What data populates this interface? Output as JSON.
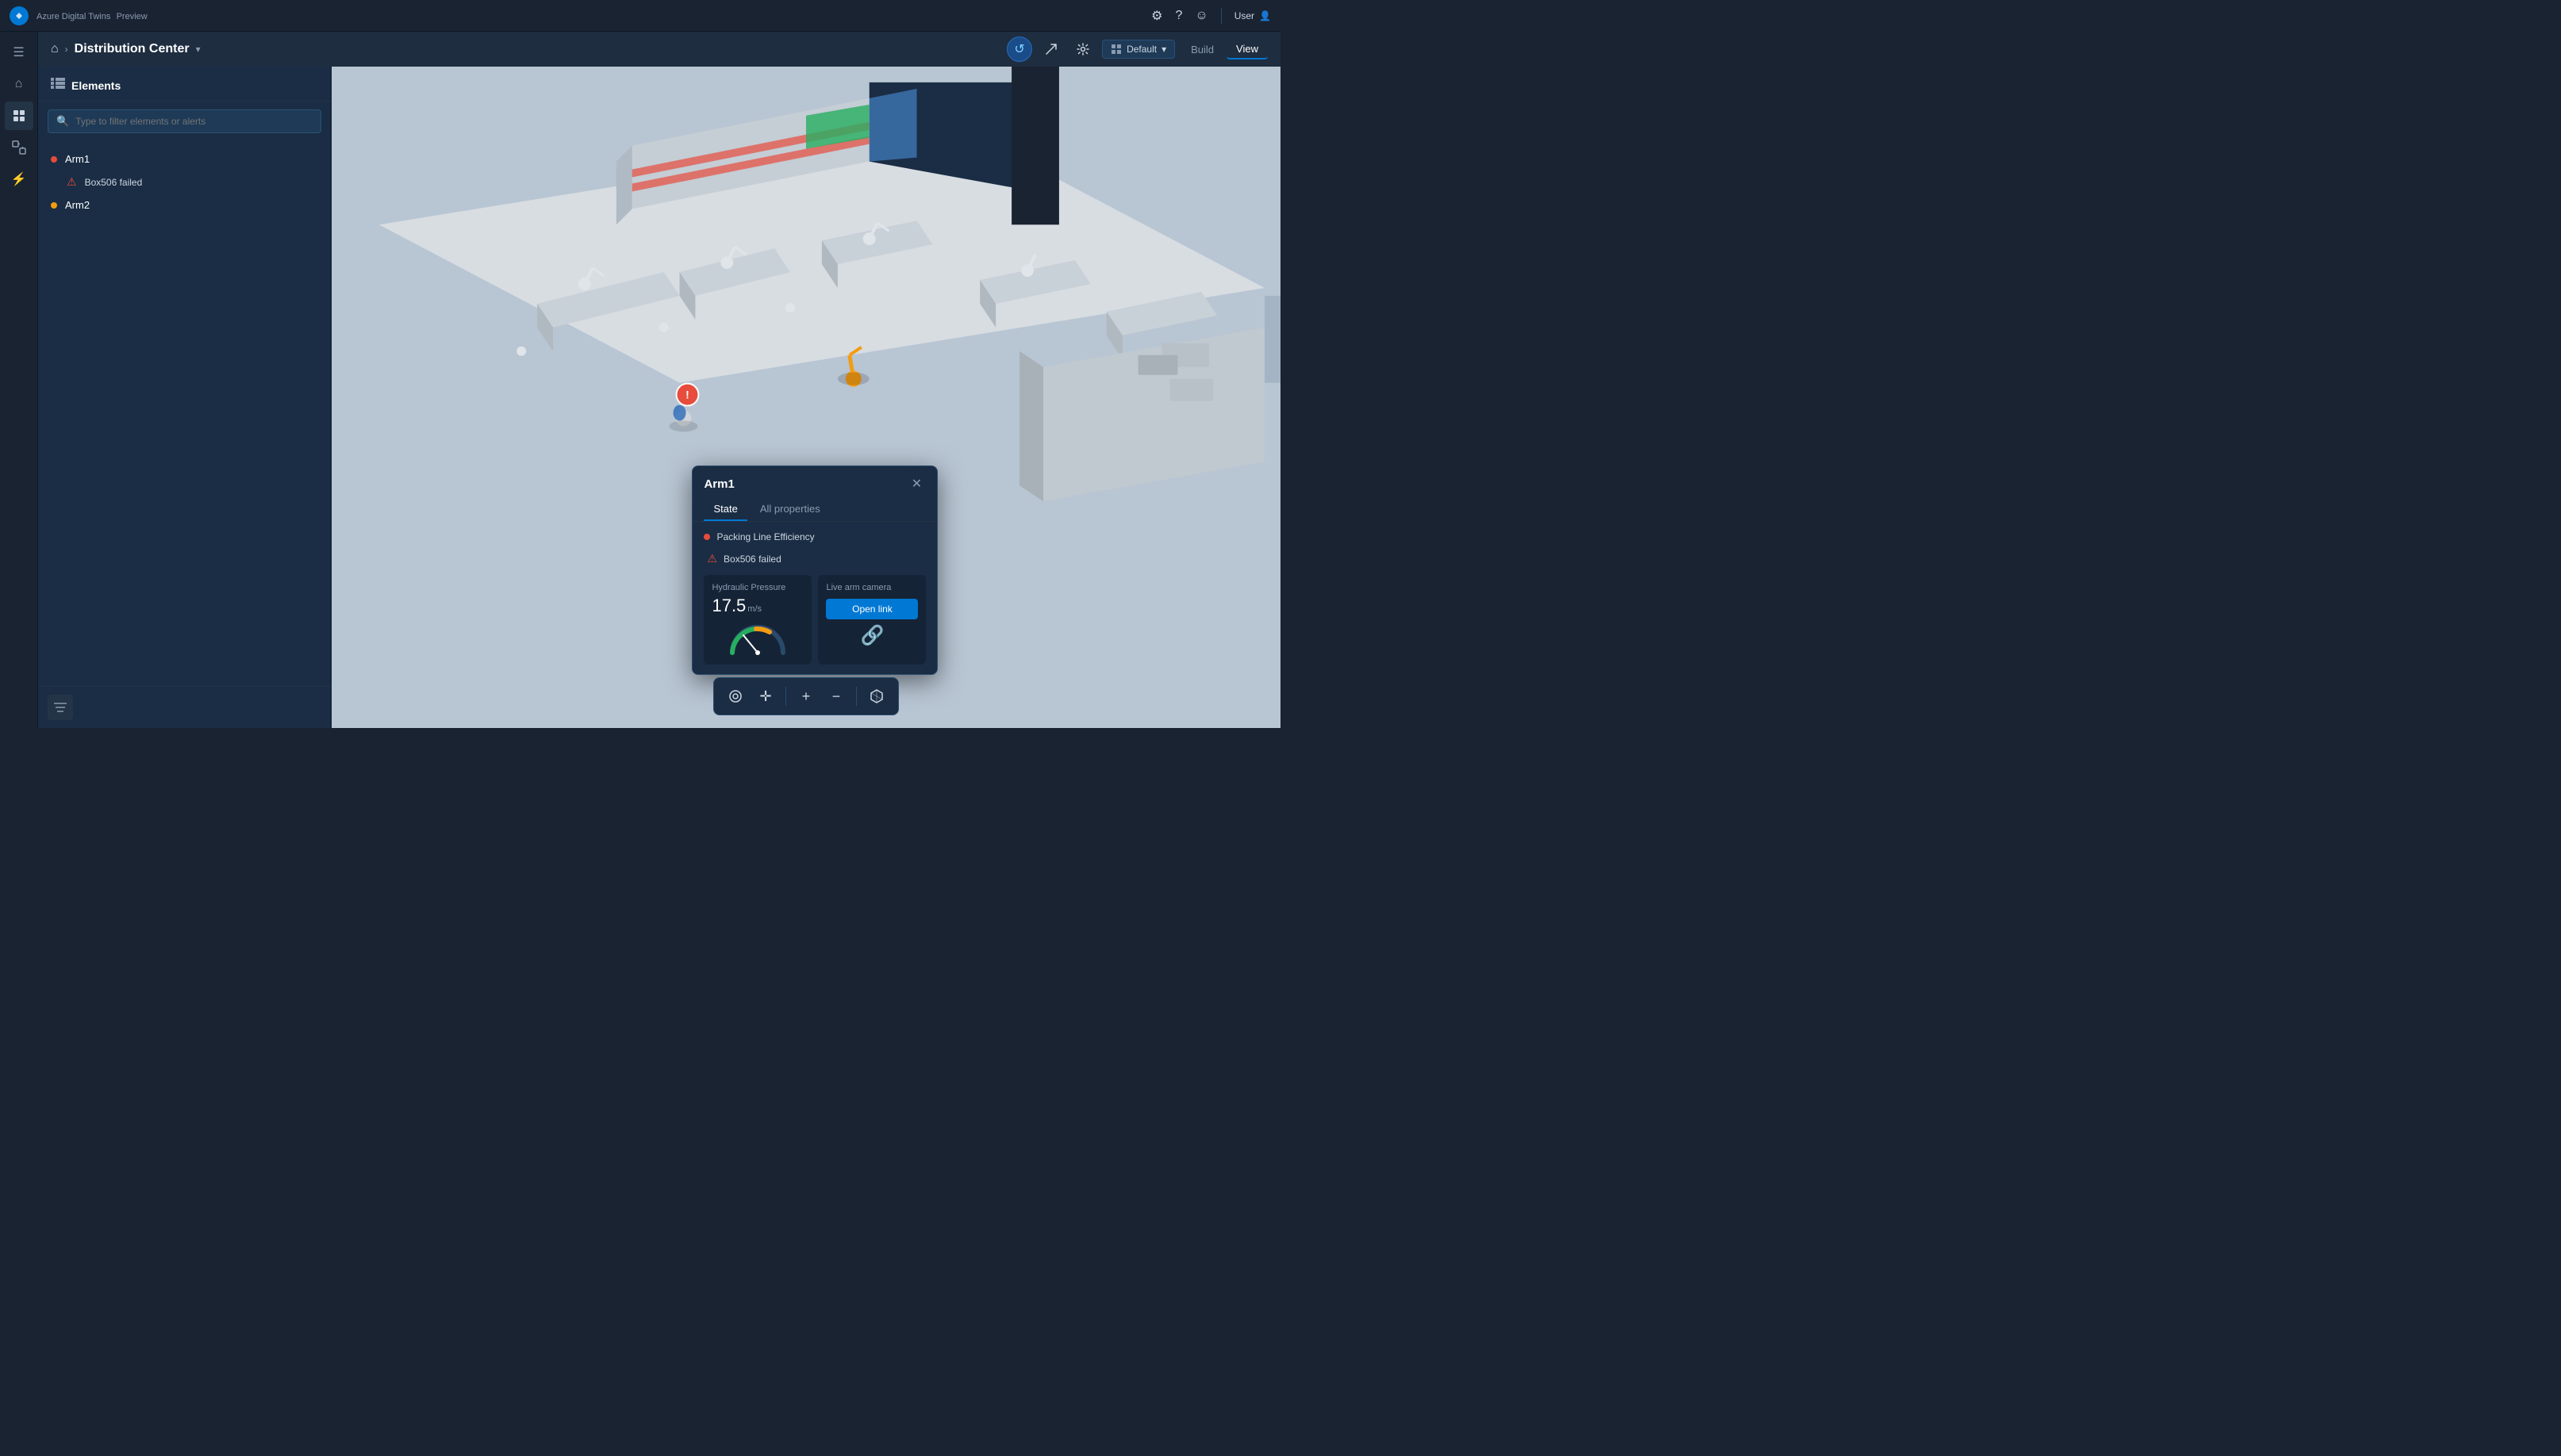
{
  "app": {
    "logo": "A",
    "name": "Azure Digital Twins",
    "preview_label": "Preview",
    "user": "User",
    "icons": {
      "settings": "⚙",
      "help": "?",
      "emoji": "☺",
      "user_manage": "👤"
    }
  },
  "topbar": {
    "settings_label": "Settings",
    "help_label": "Help",
    "user_label": "User"
  },
  "breadcrumb": {
    "home_icon": "⌂",
    "separator": "›",
    "title": "Distribution Center",
    "chevron": "▾"
  },
  "toolbar": {
    "refresh_icon": "↺",
    "share_icon": "↗",
    "settings_icon": "⚙",
    "dropdown_label": "Default",
    "build_label": "Build",
    "view_label": "View"
  },
  "sidebar": {
    "title": "Elements",
    "search_placeholder": "Type to filter elements or alerts",
    "items": [
      {
        "id": "arm1",
        "name": "Arm1",
        "status": "red",
        "children": [
          {
            "id": "box506",
            "name": "Box506 failed",
            "type": "alert"
          }
        ]
      },
      {
        "id": "arm2",
        "name": "Arm2",
        "status": "orange",
        "children": []
      }
    ],
    "filter_icon": "☰"
  },
  "rail": {
    "items": [
      {
        "id": "menu",
        "icon": "☰",
        "active": false
      },
      {
        "id": "home",
        "icon": "⌂",
        "active": false
      },
      {
        "id": "models",
        "icon": "◈",
        "active": true
      },
      {
        "id": "twins",
        "icon": "⧉",
        "active": false
      },
      {
        "id": "lightning",
        "icon": "⚡",
        "active": false
      }
    ]
  },
  "popup": {
    "title": "Arm1",
    "close_icon": "✕",
    "tabs": [
      {
        "id": "state",
        "label": "State",
        "active": true
      },
      {
        "id": "all_properties",
        "label": "All properties",
        "active": false
      }
    ],
    "packing_line_label": "Packing Line Efficiency",
    "alert_label": "Box506 failed",
    "hydraulic": {
      "label": "Hydraulic Pressure",
      "value": "17.5",
      "unit": "m/s"
    },
    "camera": {
      "label": "Live arm camera",
      "button_label": "Open link",
      "icon": "🔗"
    }
  },
  "bottom_toolbar": {
    "zoom_fit": "⊙",
    "move": "✛",
    "zoom_in": "+",
    "zoom_out": "−",
    "box": "◱"
  },
  "gauge": {
    "value": 17.5,
    "max": 30,
    "color_low": "#2ecc71",
    "color_high": "#f39c12"
  }
}
